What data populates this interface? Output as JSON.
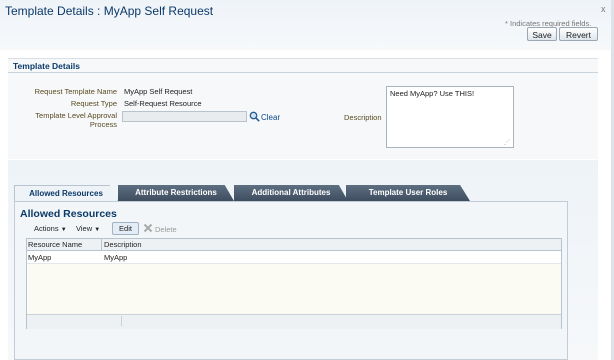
{
  "header": {
    "title": "Template Details : MyApp Self Request",
    "close_glyph": "x",
    "required_note": "* Indicates required fields.",
    "save_label": "Save",
    "revert_label": "Revert"
  },
  "details": {
    "section_title": "Template Details",
    "fields": {
      "name_label": "Request Template Name",
      "name_value": "MyApp Self Request",
      "type_label": "Request Type",
      "type_value": "Self-Request Resource",
      "approval_label": "Template Level Approval Process",
      "approval_value": "",
      "clear_label": "Clear",
      "description_label": "Description",
      "description_value": "Need MyApp? Use THIS!"
    }
  },
  "tabs": [
    {
      "label": "Allowed Resources",
      "active": true
    },
    {
      "label": "Attribute Restrictions",
      "active": false
    },
    {
      "label": "Additional Attributes",
      "active": false
    },
    {
      "label": "Template User Roles",
      "active": false
    }
  ],
  "panel": {
    "title": "Allowed Resources",
    "toolbar": {
      "actions_label": "Actions",
      "view_label": "View",
      "edit_label": "Edit",
      "delete_label": "Delete"
    },
    "table": {
      "columns": [
        "Resource Name",
        "Description"
      ],
      "rows": [
        [
          "MyApp",
          "MyApp"
        ]
      ]
    }
  },
  "icons": {
    "search": "search-icon",
    "delete": "delete-x-icon",
    "chevron": "chevron-down-icon"
  },
  "colors": {
    "title_blue": "#0b3a69",
    "label_brown": "#5a4a1f",
    "tab_dark": "#3e4d5e",
    "link_blue": "#0b4a8a"
  }
}
